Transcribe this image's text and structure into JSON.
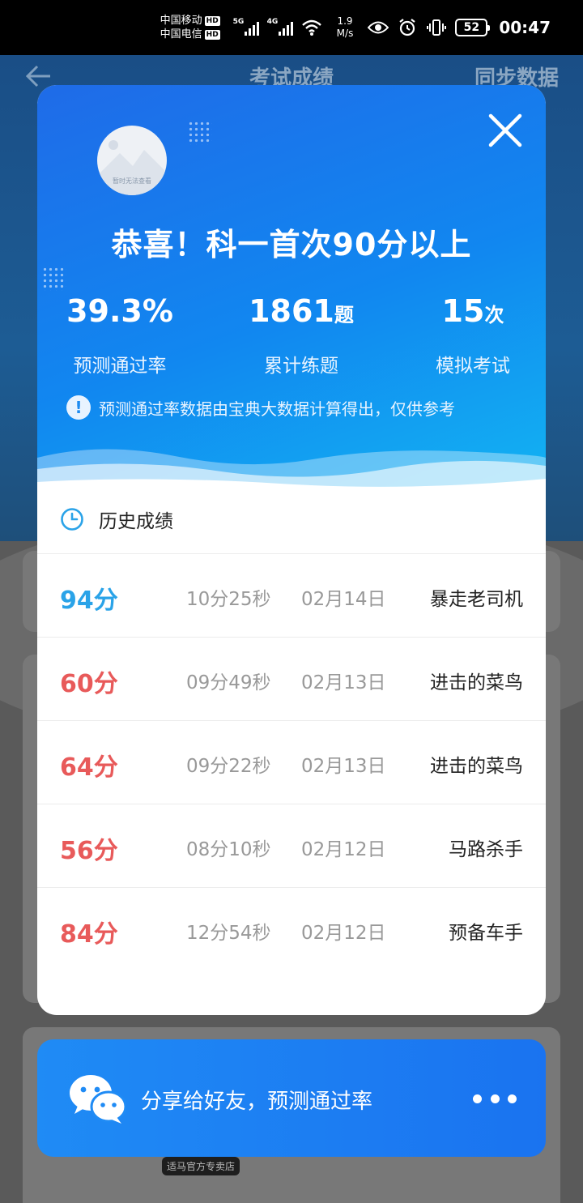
{
  "status_bar": {
    "carrier1": "中国移动",
    "carrier2": "中国电信",
    "hd_badge": "HD",
    "sig1_gen": "5G",
    "sig2_gen": "4G",
    "net_speed_value": "1.9",
    "net_speed_unit": "M/s",
    "battery": "52",
    "time": "00:47"
  },
  "background_page": {
    "title": "考试成绩",
    "sync_label": "同步数据",
    "store_badge": "适马官方专卖店"
  },
  "modal": {
    "avatar_caption": "暂时无法查看",
    "headline": "恭喜！科一首次90分以上",
    "stats": [
      {
        "value": "39.3%",
        "unit": "",
        "label": "预测通过率"
      },
      {
        "value": "1861",
        "unit": "题",
        "label": "累计练题"
      },
      {
        "value": "15",
        "unit": "次",
        "label": "模拟考试"
      }
    ],
    "note": "预测通过率数据由宝典大数据计算得出，仅供参考",
    "history_title": "历史成绩",
    "history": [
      {
        "score": "94分",
        "duration": "10分25秒",
        "date": "02月14日",
        "level": "暴走老司机",
        "color": "#2aa3e8"
      },
      {
        "score": "60分",
        "duration": "09分49秒",
        "date": "02月13日",
        "level": "进击的菜鸟",
        "color": "#e85a5a"
      },
      {
        "score": "64分",
        "duration": "09分22秒",
        "date": "02月13日",
        "level": "进击的菜鸟",
        "color": "#e85a5a"
      },
      {
        "score": "56分",
        "duration": "08分10秒",
        "date": "02月12日",
        "level": "马路杀手",
        "color": "#e85a5a"
      },
      {
        "score": "84分",
        "duration": "12分54秒",
        "date": "02月12日",
        "level": "预备车手",
        "color": "#e85a5a"
      }
    ]
  },
  "share": {
    "label": "分享给好友，预测通过率"
  },
  "colors": {
    "accent_blue": "#1a7ff0",
    "pass_score": "#2aa3e8",
    "fail_score": "#e85a5a"
  }
}
